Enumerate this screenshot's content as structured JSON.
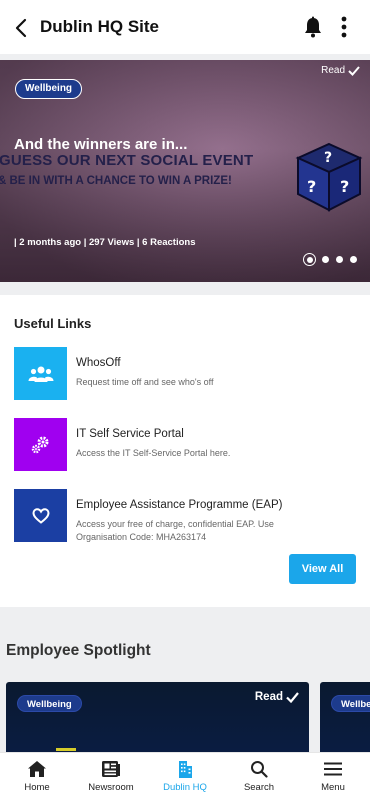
{
  "header": {
    "title": "Dublin HQ Site"
  },
  "hero": {
    "badge": "Wellbeing",
    "read_label": "Read",
    "title": "And the winners are in...",
    "image_line1": "GUESS OUR NEXT SOCIAL EVENT",
    "image_line2": "& BE IN WITH A CHANCE TO WIN A PRIZE!",
    "meta": "| 2 months ago | 297 Views | 6 Reactions",
    "slide_index": 1,
    "slide_count": 4
  },
  "useful_links": {
    "title": "Useful Links",
    "items": [
      {
        "name": "WhosOff",
        "description": "Request time off and see who's off",
        "icon": "people-icon",
        "color": "#1ab1f0"
      },
      {
        "name": "IT Self Service Portal",
        "description": "Access the IT Self-Service Portal here.",
        "icon": "gears-icon",
        "color": "#a000f0"
      },
      {
        "name": "Employee Assistance Programme (EAP)",
        "description": "Access your free of charge, confidential EAP. Use Organisation Code: MHA263174",
        "icon": "heart-icon",
        "color": "#1b3fa3"
      }
    ],
    "view_all_label": "View All"
  },
  "spotlight": {
    "title": "Employee Spotlight",
    "cards": [
      {
        "badge": "Wellbeing",
        "read_label": "Read"
      },
      {
        "badge": "Wellbeing"
      }
    ]
  },
  "bottom_nav": {
    "items": [
      {
        "label": "Home",
        "icon": "home-icon"
      },
      {
        "label": "Newsroom",
        "icon": "newspaper-icon"
      },
      {
        "label": "Dublin HQ",
        "icon": "buildings-icon",
        "active": true
      },
      {
        "label": "Search",
        "icon": "search-icon"
      },
      {
        "label": "Menu",
        "icon": "menu-icon"
      }
    ]
  },
  "colors": {
    "accent": "#1ba6ea",
    "badge": "#1d3b8c"
  }
}
